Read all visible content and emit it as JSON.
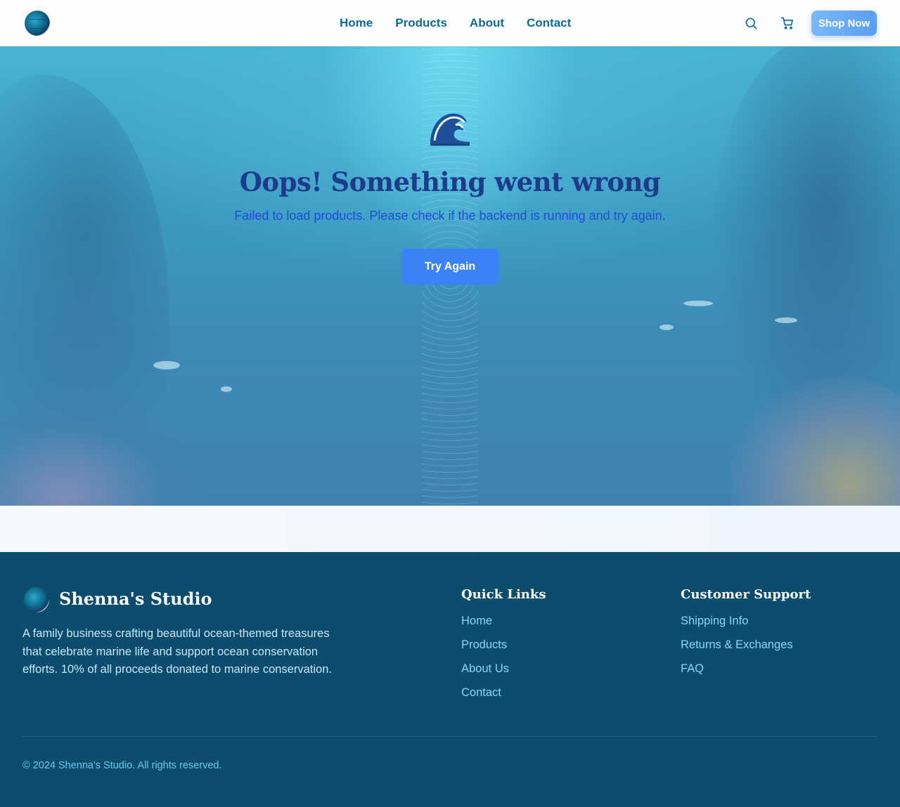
{
  "header": {
    "nav": [
      "Home",
      "Products",
      "About",
      "Contact"
    ],
    "shop_now": "Shop Now",
    "icons": [
      "search-icon",
      "cart-icon"
    ]
  },
  "error": {
    "icon": "wave-icon",
    "title": "Oops! Something went wrong",
    "message": "Failed to load products. Please check if the backend is running and try again.",
    "retry_label": "Try Again"
  },
  "footer": {
    "brand": "Shenna's Studio",
    "description": "A family business crafting beautiful ocean-themed treasures that celebrate marine life and support ocean conservation efforts. 10% of all proceeds donated to marine conservation.",
    "quick_links": {
      "title": "Quick Links",
      "items": [
        "Home",
        "Products",
        "About Us",
        "Contact"
      ]
    },
    "support": {
      "title": "Customer Support",
      "items": [
        "Shipping Info",
        "Returns & Exchanges",
        "FAQ"
      ]
    },
    "copyright": "© 2024 Shenna's Studio. All rights reserved."
  },
  "colors": {
    "primary": "#3b82f6",
    "nav_link": "#0c6b9a",
    "title": "#1e3a8a",
    "footer_bg": "#0c4d6e",
    "footer_link": "#8fd3f5"
  }
}
